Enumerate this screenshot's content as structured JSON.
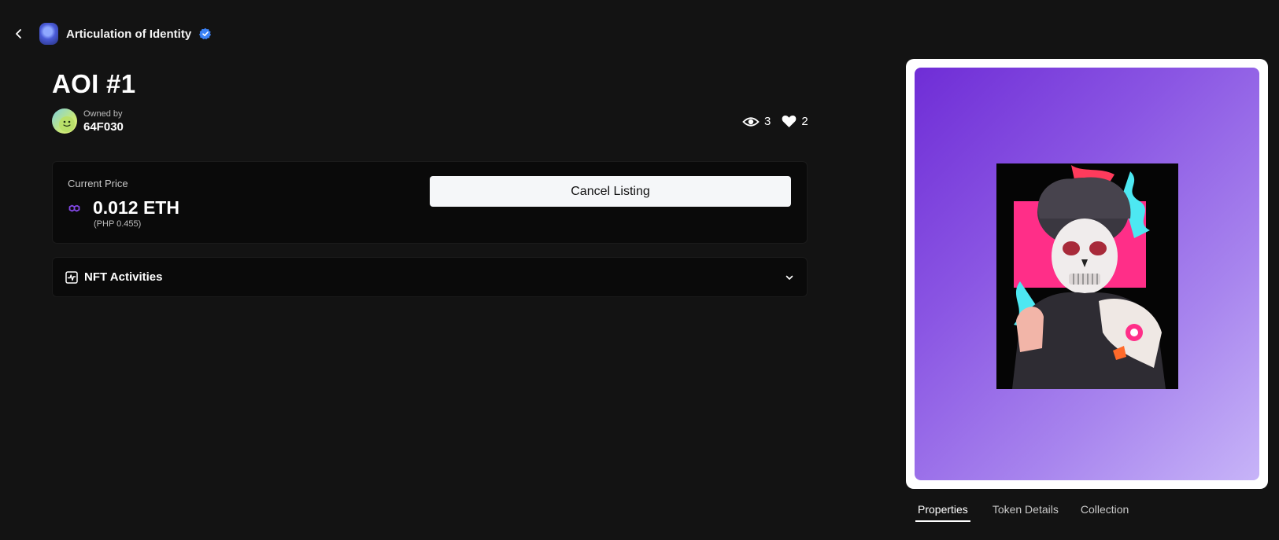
{
  "header": {
    "collection_name": "Articulation of Identity",
    "icons": {
      "back": "chevron-left-icon",
      "verified": "verified-badge-icon"
    },
    "verified_color": "#3b82f6"
  },
  "nft": {
    "title": "AOI #1",
    "owner_label": "Owned by",
    "owner_name": "64F030",
    "views": "3",
    "likes": "2"
  },
  "price": {
    "label": "Current Price",
    "value": "0.012 ETH",
    "fiat": "(PHP 0.455)",
    "currency_icon": "polygon-icon",
    "currency_icon_color": "#8247e5"
  },
  "actions": {
    "cancel_label": "Cancel Listing"
  },
  "activities": {
    "label": "NFT Activities",
    "icon": "activity-icon"
  },
  "preview": {
    "gradient_start": "#6f2dd6",
    "gradient_end": "#c7b4f8"
  },
  "tabs": [
    {
      "label": "Properties",
      "active": true
    },
    {
      "label": "Token Details",
      "active": false
    },
    {
      "label": "Collection",
      "active": false
    }
  ]
}
